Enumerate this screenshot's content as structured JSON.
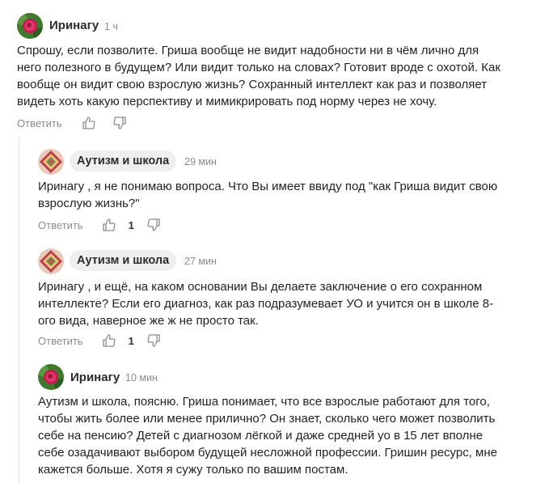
{
  "comments": [
    {
      "author": "Иринагу",
      "time": "1 ч",
      "lines": [
        "Спрошу, если позволите. Гриша вообще не видит надобности ни в чём лично для",
        "него полезного в будущем? Или видит только на словах? Готовит вроде с охотой. Как",
        "вообще он видит свою взрослую жизнь? Сохранный интеллект как раз и позволяет",
        "видеть хоть какую перспективу и мимикрировать под норму через не хочу."
      ],
      "reply_label": "Ответить",
      "likes": ""
    },
    {
      "author": "Аутизм и школа",
      "time": "29 мин",
      "lines": [
        "Иринагу , я не понимаю вопроса. Что Вы имеет ввиду под \"как Гриша видит свою",
        "взрослую жизнь?\""
      ],
      "reply_label": "Ответить",
      "likes": "1"
    },
    {
      "author": "Аутизм и школа",
      "time": "27 мин",
      "lines": [
        "Иринагу , и ещё, на каком основании Вы делаете заключение о его сохранном",
        "интеллекте? Если его диагноз, как раз подразумевает УО и учится он в школе 8-",
        "ого вида, наверное же ж не просто так."
      ],
      "reply_label": "Ответить",
      "likes": "1"
    },
    {
      "author": "Иринагу",
      "time": "10 мин",
      "lines": [
        "Аутизм и школа, поясню. Гриша понимает, что все взрослые работают для того,",
        "чтобы жить более или менее прилично? Он знает, сколько чего может позволить",
        "себе на пенсию? Детей с диагнозом лёгкой и даже средней уо в 15 лет вполне",
        "себе озадачивают выбором будущей несложной профессии. Гришин ресурс, мне",
        "кажется больше. Хотя я сужу только по вашим постам."
      ],
      "reply_label": "Ответить",
      "likes": ""
    }
  ],
  "icons": {
    "avatar_irinagu": "rose-avatar-icon",
    "avatar_autism": "diamond-ornament-avatar-icon",
    "like": "thumbs-up-icon",
    "dislike": "thumbs-down-icon"
  }
}
